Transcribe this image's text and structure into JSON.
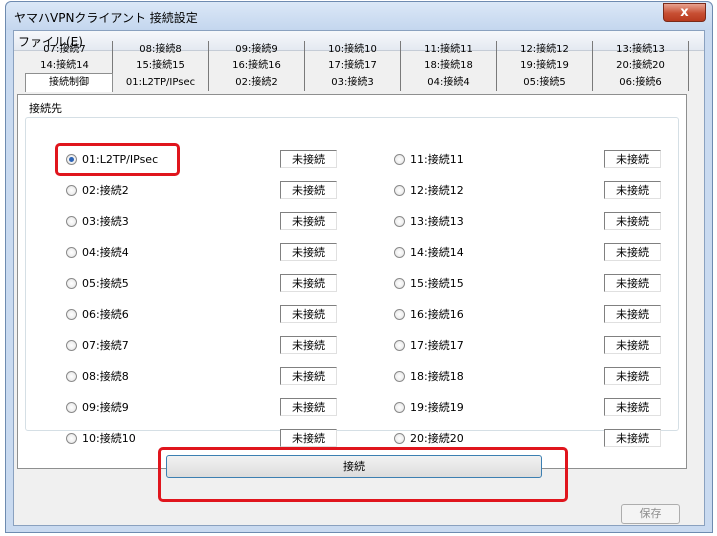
{
  "window": {
    "title": "ヤマハVPNクライアント 接続設定",
    "close_symbol": "x"
  },
  "menu": {
    "file": "ファイル(E)"
  },
  "tabs": {
    "row1": [
      "07:接続7",
      "08:接続8",
      "09:接続9",
      "10:接続10",
      "11:接続11",
      "12:接続12",
      "13:接続13"
    ],
    "row2": [
      "14:接続14",
      "15:接続15",
      "16:接続16",
      "17:接続17",
      "18:接続18",
      "19:接続19",
      "20:接続20"
    ],
    "row3": [
      "接続制御",
      "01:L2TP/IPsec",
      "02:接続2",
      "03:接続3",
      "04:接続4",
      "05:接続5",
      "06:接続6"
    ],
    "active": "接続制御"
  },
  "group": {
    "label": "接続先"
  },
  "connections_left": [
    {
      "label": "01:L2TP/IPsec",
      "status": "未接続",
      "selected": true
    },
    {
      "label": "02:接続2",
      "status": "未接続",
      "selected": false
    },
    {
      "label": "03:接続3",
      "status": "未接続",
      "selected": false
    },
    {
      "label": "04:接続4",
      "status": "未接続",
      "selected": false
    },
    {
      "label": "05:接続5",
      "status": "未接続",
      "selected": false
    },
    {
      "label": "06:接続6",
      "status": "未接続",
      "selected": false
    },
    {
      "label": "07:接続7",
      "status": "未接続",
      "selected": false
    },
    {
      "label": "08:接続8",
      "status": "未接続",
      "selected": false
    },
    {
      "label": "09:接続9",
      "status": "未接続",
      "selected": false
    },
    {
      "label": "10:接続10",
      "status": "未接続",
      "selected": false
    }
  ],
  "connections_right": [
    {
      "label": "11:接続11",
      "status": "未接続",
      "selected": false
    },
    {
      "label": "12:接続12",
      "status": "未接続",
      "selected": false
    },
    {
      "label": "13:接続13",
      "status": "未接続",
      "selected": false
    },
    {
      "label": "14:接続14",
      "status": "未接続",
      "selected": false
    },
    {
      "label": "15:接続15",
      "status": "未接続",
      "selected": false
    },
    {
      "label": "16:接続16",
      "status": "未接続",
      "selected": false
    },
    {
      "label": "17:接続17",
      "status": "未接続",
      "selected": false
    },
    {
      "label": "18:接続18",
      "status": "未接続",
      "selected": false
    },
    {
      "label": "19:接続19",
      "status": "未接続",
      "selected": false
    },
    {
      "label": "20:接続20",
      "status": "未接続",
      "selected": false
    }
  ],
  "buttons": {
    "connect": "接続",
    "save": "保存"
  },
  "colors": {
    "highlight": "#e0151d",
    "accent": "#2c63b5"
  }
}
